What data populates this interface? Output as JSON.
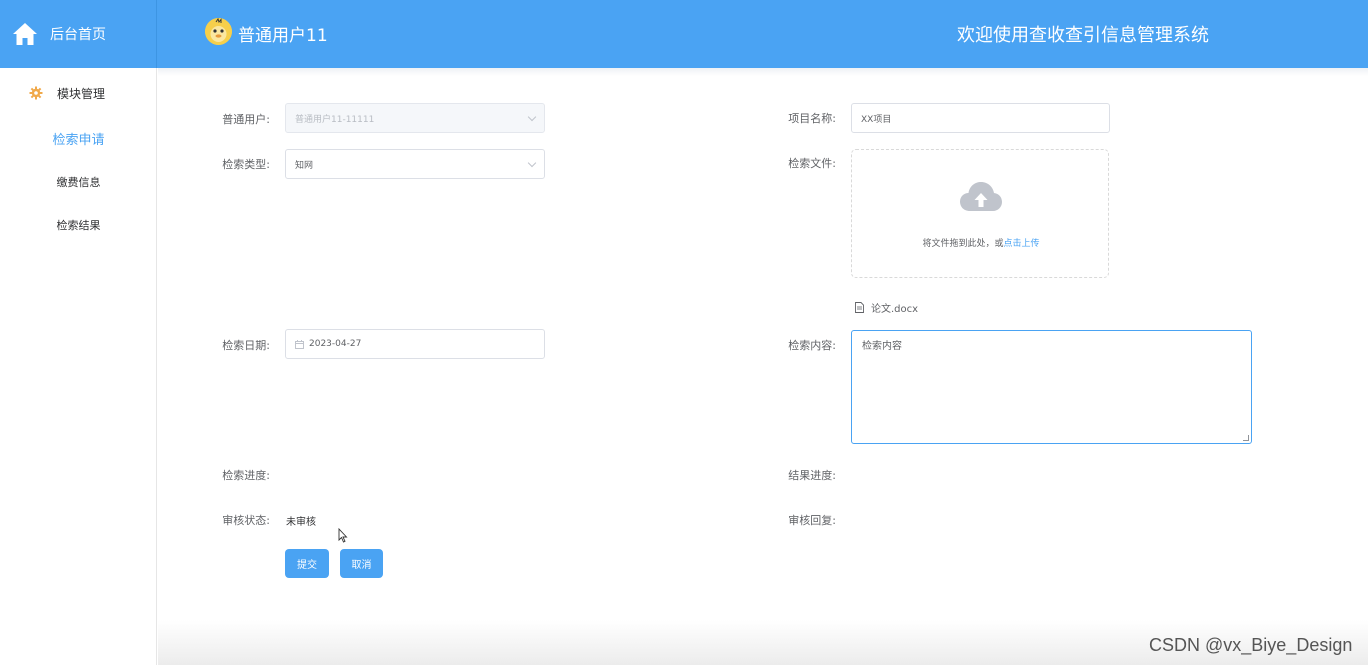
{
  "header": {
    "home_label": "后台首页",
    "username": "普通用户11",
    "system_title": "欢迎使用查收查引信息管理系统"
  },
  "sidebar": {
    "group_label": "模块管理",
    "items": [
      {
        "label": "检索申请",
        "active": true
      },
      {
        "label": "缴费信息",
        "active": false
      },
      {
        "label": "检索结果",
        "active": false
      }
    ]
  },
  "form": {
    "user": {
      "label": "普通用户:",
      "value": "普通用户11-11111"
    },
    "project_name": {
      "label": "项目名称:",
      "value": "XX项目"
    },
    "search_type": {
      "label": "检索类型:",
      "value": "知网"
    },
    "search_file": {
      "label": "检索文件:",
      "upload_text": "将文件拖到此处，或",
      "upload_link": "点击上传",
      "file_name": "论文.docx"
    },
    "search_date": {
      "label": "检索日期:",
      "value": "2023-04-27"
    },
    "search_content": {
      "label": "检索内容:",
      "value": "检索内容"
    },
    "search_progress": {
      "label": "检索进度:"
    },
    "result_progress": {
      "label": "结果进度:"
    },
    "review_status": {
      "label": "审核状态:",
      "value": "未审核"
    },
    "review_reply": {
      "label": "审核回复:"
    },
    "submit_label": "提交",
    "cancel_label": "取消"
  },
  "watermark": "CSDN @vx_Biye_Design",
  "colors": {
    "primary": "#4aa3f3",
    "sidebar_active": "#4aa3f3",
    "gear": "#f0a94a"
  }
}
